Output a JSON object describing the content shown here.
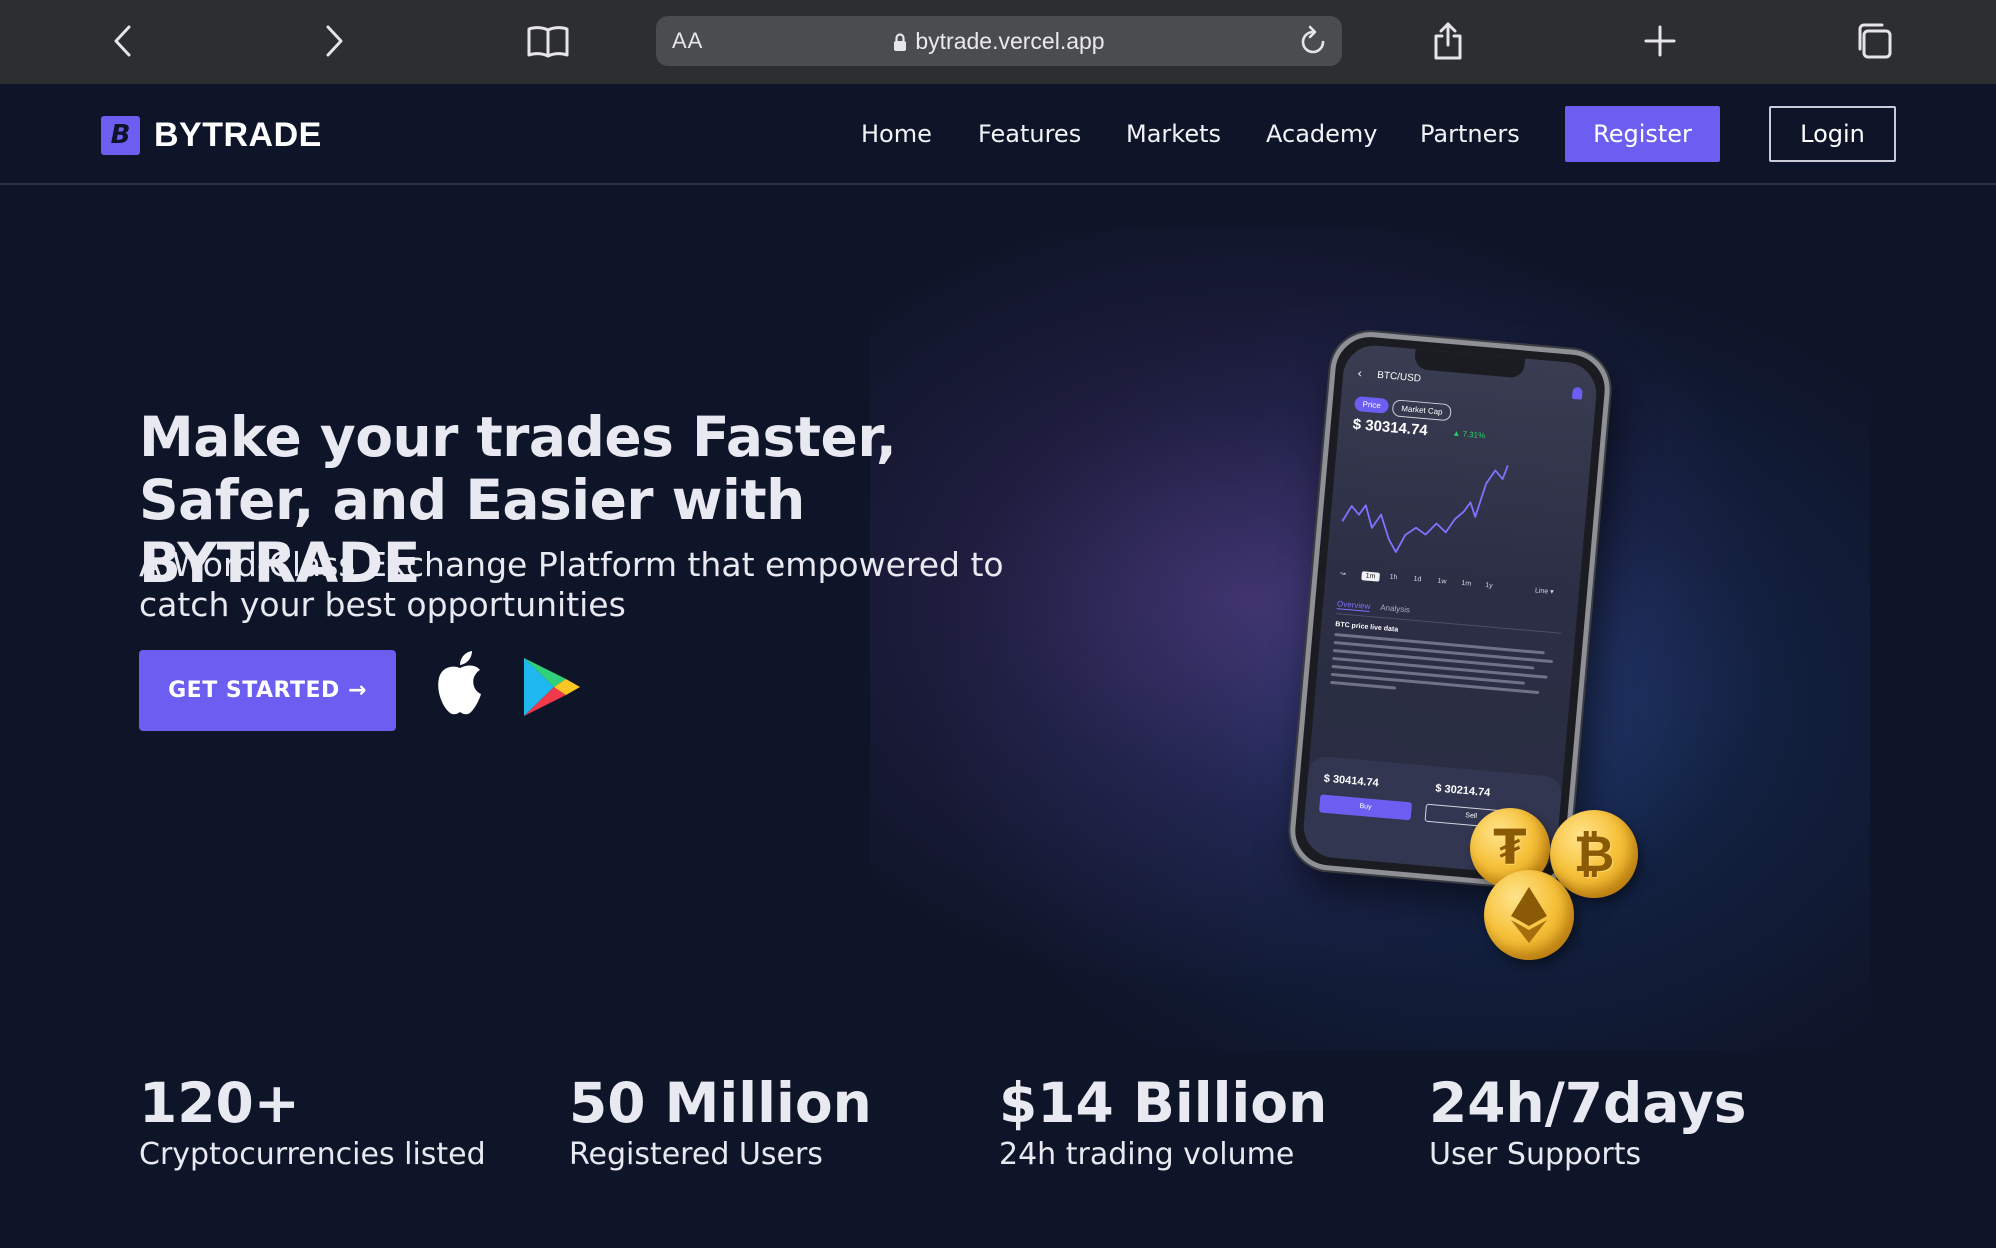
{
  "browser": {
    "text_size_label": "AA",
    "url": "bytrade.vercel.app"
  },
  "header": {
    "logo_mark": "B",
    "brand": "BYTRADE",
    "nav": [
      "Home",
      "Features",
      "Markets",
      "Academy",
      "Partners"
    ],
    "register_label": "Register",
    "login_label": "Login"
  },
  "hero": {
    "title": "Make your trades Faster, Safer, and Easier with BYTRADE",
    "subtitle": "A Word-Class Exchange Platform that empowered to catch your best opportunities",
    "cta_label": "GET STARTED →"
  },
  "phone": {
    "pair": "BTC/USD",
    "tab_price": "Price",
    "tab_market_cap": "Market Cap",
    "price": "$ 30314.74",
    "change": "▲ 7.31%",
    "ranges": [
      "1m",
      "1h",
      "1d",
      "1w",
      "1m",
      "1y",
      "Line ▾"
    ],
    "tab_overview": "Overview",
    "tab_analysis": "Analysis",
    "info_title": "BTC price live data",
    "buy_price": "$ 30414.74",
    "sell_price": "$ 30214.74",
    "buy_label": "Buy",
    "sell_label": "Sell"
  },
  "stats": [
    {
      "value": "120+",
      "label": "Cryptocurrencies listed"
    },
    {
      "value": "50 Million",
      "label": "Registered Users"
    },
    {
      "value": "$14 Billion",
      "label": "24h trading volume"
    },
    {
      "value": "24h/7days",
      "label": "User Supports"
    }
  ],
  "colors": {
    "accent": "#6b5ef0",
    "background": "#0f1529",
    "browser_chrome": "#2c2e31",
    "positive": "#2bd46b"
  },
  "icons": {
    "apple": "apple-icon",
    "google_play": "google-play-icon",
    "coins": [
      "tether-coin-icon",
      "bitcoin-coin-icon",
      "ethereum-coin-icon"
    ]
  }
}
